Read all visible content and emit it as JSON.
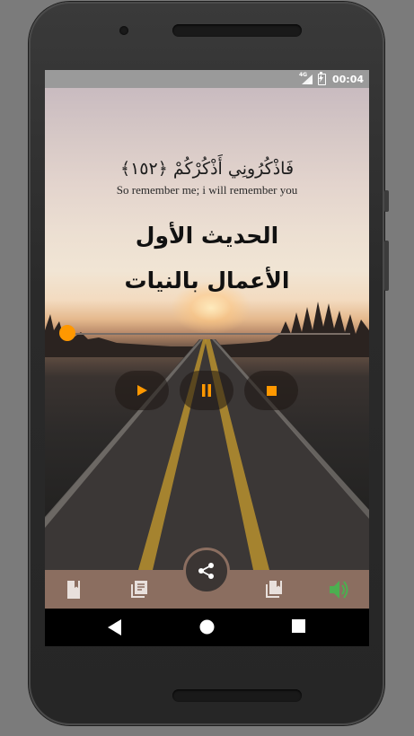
{
  "status_bar": {
    "network_label": "4G",
    "time": "00:04"
  },
  "verse": {
    "arabic": "فَاذْكُرُونِي أَذْكُرْكُمْ ﴿١٥٢﴾",
    "english": "So remember me; i will remember you"
  },
  "hadith": {
    "title_line1": "الحديث الأول",
    "title_line2": "الأعمال بالنيات"
  },
  "player": {
    "progress": 0.0,
    "controls": [
      "play",
      "pause",
      "stop"
    ]
  },
  "bottom_nav": {
    "tabs": [
      "book-icon",
      "library-icon",
      "share-icon",
      "collection-icon",
      "volume-icon"
    ],
    "accent_color": "#4caf50"
  },
  "colors": {
    "accent": "#ff9800",
    "bottom_bar": "#8b6e60"
  }
}
